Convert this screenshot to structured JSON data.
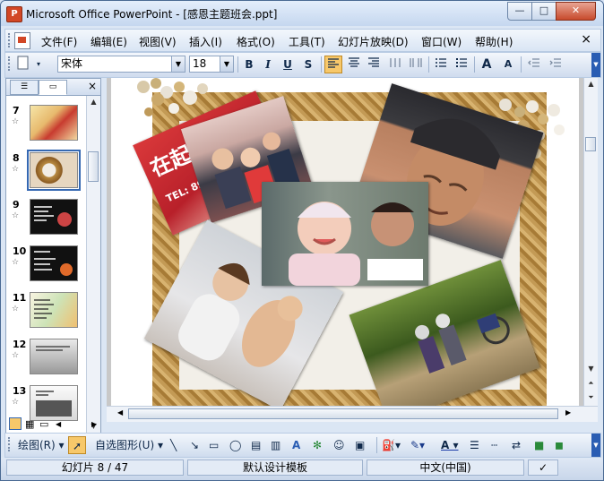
{
  "window": {
    "title": "Microsoft Office PowerPoint - [感恩主题班会.ppt]",
    "app_icon": "powerpoint-icon",
    "controls": {
      "minimize": "—",
      "maximize": "□",
      "close": "✕"
    }
  },
  "menu": {
    "items": [
      {
        "label": "文件(F)"
      },
      {
        "label": "编辑(E)"
      },
      {
        "label": "视图(V)"
      },
      {
        "label": "插入(I)"
      },
      {
        "label": "格式(O)"
      },
      {
        "label": "工具(T)"
      },
      {
        "label": "幻灯片放映(D)"
      },
      {
        "label": "窗口(W)"
      },
      {
        "label": "帮助(H)"
      }
    ],
    "close": "×"
  },
  "format_toolbar": {
    "font_name": "宋体",
    "font_size": "18",
    "bold": "B",
    "italic": "I",
    "underline": "U",
    "shadow": "S",
    "grow_font": "A",
    "shrink_font": "A"
  },
  "outline_pane": {
    "close": "×",
    "slides": [
      {
        "num": "7"
      },
      {
        "num": "8",
        "selected": true
      },
      {
        "num": "9"
      },
      {
        "num": "10"
      },
      {
        "num": "11"
      },
      {
        "num": "12"
      },
      {
        "num": "13"
      }
    ],
    "star": "☆"
  },
  "slide": {
    "sign_text": "在起点",
    "sign_sub": "TEL: 89495"
  },
  "drawing_toolbar": {
    "draw_label": "绘图(R)",
    "autoshapes_label": "自选图形(U)"
  },
  "status": {
    "slide_info": "幻灯片 8 / 47",
    "design": "默认设计模板",
    "language": "中文(中国)"
  },
  "colors": {
    "accent": "#3568b2",
    "frame_gold": "#b88a42",
    "title_gradient_top": "#e4eefb"
  }
}
